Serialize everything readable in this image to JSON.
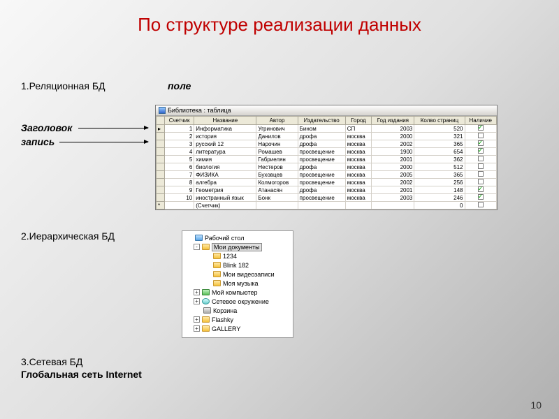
{
  "title": "По структуре реализации данных",
  "labels": {
    "relational": "1.Реляционная БД",
    "field": "поле",
    "header": "Заголовок",
    "record": "запись",
    "hierarchical": "2.Иерархическая БД",
    "network": "3.Сетевая БД",
    "internet": "Глобальная сеть Internet"
  },
  "table": {
    "title": "Библиотека : таблица",
    "columns": [
      "Счетчик",
      "Название",
      "Автор",
      "Издательство",
      "Город",
      "Год издания",
      "Колво страниц",
      "Наличие"
    ],
    "rows": [
      {
        "n": 1,
        "name": "Информатика",
        "author": "Угринович",
        "pub": "Бином",
        "city": "СП",
        "year": 2003,
        "pages": 520,
        "avail": true
      },
      {
        "n": 2,
        "name": "история",
        "author": "Данилов",
        "pub": "дрофа",
        "city": "москва",
        "year": 2000,
        "pages": 321,
        "avail": false
      },
      {
        "n": 3,
        "name": "русский 12",
        "author": "Нарочин",
        "pub": "дрофа",
        "city": "москва",
        "year": 2002,
        "pages": 365,
        "avail": true
      },
      {
        "n": 4,
        "name": "литература",
        "author": "Ромашев",
        "pub": "просвещение",
        "city": "москва",
        "year": 1900,
        "pages": 654,
        "avail": true
      },
      {
        "n": 5,
        "name": "химия",
        "author": "Габриелян",
        "pub": "просвещение",
        "city": "москва",
        "year": 2001,
        "pages": 362,
        "avail": false
      },
      {
        "n": 6,
        "name": "биология",
        "author": "Нестеров",
        "pub": "дрофа",
        "city": "москва",
        "year": 2000,
        "pages": 512,
        "avail": false
      },
      {
        "n": 7,
        "name": "ФИЗИКА",
        "author": "Буховцев",
        "pub": "просвещение",
        "city": "москва",
        "year": 2005,
        "pages": 365,
        "avail": false
      },
      {
        "n": 8,
        "name": "алгебра",
        "author": "Колмогоров",
        "pub": "просвещение",
        "city": "москва",
        "year": 2002,
        "pages": 256,
        "avail": false
      },
      {
        "n": 9,
        "name": "Геометрия",
        "author": "Атанасян",
        "pub": "дрофа",
        "city": "москва",
        "year": 2001,
        "pages": 148,
        "avail": true
      },
      {
        "n": 10,
        "name": "иностранный язык",
        "author": "Бонк",
        "pub": "просвещение",
        "city": "москва",
        "year": 2003,
        "pages": 246,
        "avail": true
      }
    ],
    "footer": {
      "label": "(Счетчик)",
      "pages": 0
    }
  },
  "tree": {
    "items": [
      {
        "level": 0,
        "exp": "",
        "icon": "blue",
        "text": "Рабочий стол",
        "sel": false
      },
      {
        "level": 1,
        "exp": "-",
        "icon": "folder",
        "text": "Мои документы",
        "sel": true
      },
      {
        "level": 2,
        "exp": "",
        "icon": "folder",
        "text": "1234",
        "sel": false
      },
      {
        "level": 2,
        "exp": "",
        "icon": "folder",
        "text": "Blink 182",
        "sel": false
      },
      {
        "level": 2,
        "exp": "",
        "icon": "folder",
        "text": "Мои видеозаписи",
        "sel": false
      },
      {
        "level": 2,
        "exp": "",
        "icon": "folder",
        "text": "Моя музыка",
        "sel": false
      },
      {
        "level": 1,
        "exp": "+",
        "icon": "green",
        "text": "Мой компьютер",
        "sel": false
      },
      {
        "level": 1,
        "exp": "+",
        "icon": "blob",
        "text": "Сетевое окружение",
        "sel": false
      },
      {
        "level": 1,
        "exp": "",
        "icon": "bin",
        "text": "Корзина",
        "sel": false
      },
      {
        "level": 1,
        "exp": "+",
        "icon": "folder",
        "text": "Flashky",
        "sel": false
      },
      {
        "level": 1,
        "exp": "+",
        "icon": "folder",
        "text": "GALLERY",
        "sel": false
      }
    ]
  },
  "page_number": "10"
}
